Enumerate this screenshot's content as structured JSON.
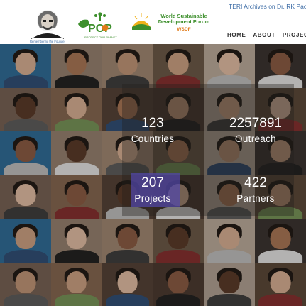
{
  "header": {
    "top_link": "TERI Archives on Dr. RK Pac",
    "logos": {
      "teri_caption": "Remembering the Founder",
      "pop_text": "POP",
      "pop_caption": "PROTECT OUR PLANET",
      "wsdf_title": "World Sustainable Development Forum",
      "wsdf_subtitle": "WSDF"
    },
    "nav": [
      {
        "label": "HOME",
        "active": true
      },
      {
        "label": "ABOUT"
      },
      {
        "label": "PROJECTS"
      }
    ]
  },
  "stats": [
    {
      "value": "123",
      "label": "Countries"
    },
    {
      "value": "2257891",
      "label": "Outreach"
    },
    {
      "value": "207",
      "label": "Projects"
    },
    {
      "value": "422",
      "label": "Partners"
    }
  ],
  "colors": {
    "brand_green": "#3d8f2c",
    "brand_orange": "#e07a18",
    "link_blue": "#3b6ba5",
    "projects_highlight": "#5246aa"
  }
}
